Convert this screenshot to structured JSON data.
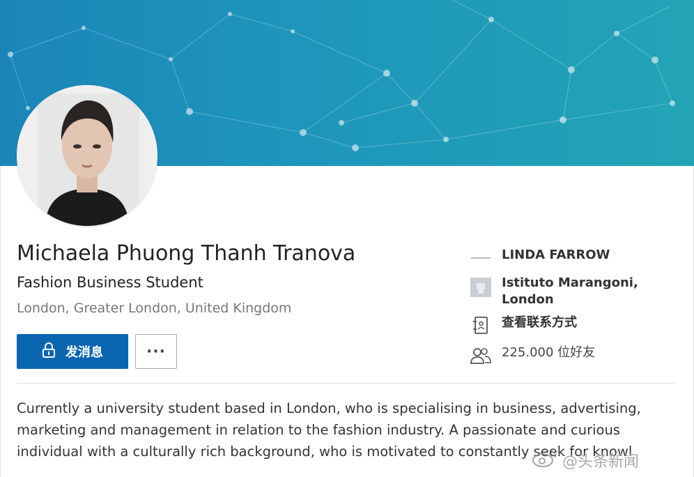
{
  "profile": {
    "name": "Michaela Phuong Thanh Tranova",
    "headline": "Fashion Business Student",
    "location": "London, Greater London, United Kingdom"
  },
  "actions": {
    "message_label": "发消息",
    "more_label": "···"
  },
  "sidebar": {
    "company": "LINDA FARROW",
    "school_line1": "Istituto Marangoni,",
    "school_line2": "London",
    "contact_info": "查看联系方式",
    "connections": "225.000 位好友"
  },
  "about": {
    "line1": "Currently a university student based in London, who is specialising in business, advertising,",
    "line2": "marketing and management in relation to the fashion industry. A passionate and curious",
    "line3": "individual with a culturally rich background, who is motivated to constantly seek for knowl"
  },
  "watermark": {
    "text": "@头条新闻"
  },
  "icons": {
    "message": "lock-icon",
    "school": "school-logo-icon",
    "contact": "address-book-icon",
    "connections": "people-icon"
  },
  "colors": {
    "primary": "#0a66b0",
    "banner_start": "#1a86b8",
    "banner_end": "#22a4b6"
  }
}
